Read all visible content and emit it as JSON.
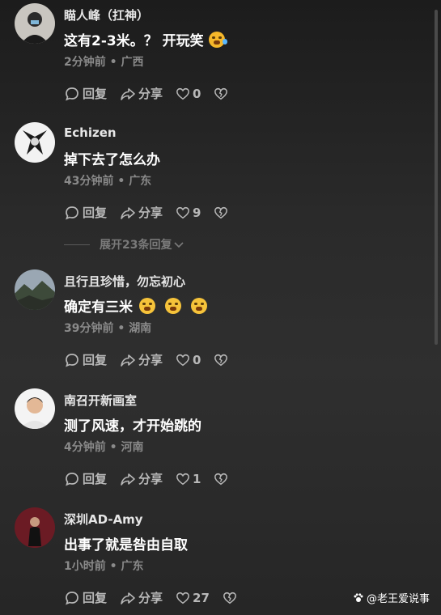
{
  "actions": {
    "reply": "回复",
    "share": "分享"
  },
  "comments": [
    {
      "username": "瞄人峰（扛神）",
      "text": "这有2-3米。？ 开玩笑",
      "time": "2分钟前",
      "location": "广西",
      "likes": "0"
    },
    {
      "username": "Echizen",
      "text": "掉下去了怎么办",
      "time": "43分钟前",
      "location": "广东",
      "likes": "9"
    },
    {
      "username": "且行且珍惜，勿忘初心",
      "text": "确定有三米",
      "time": "39分钟前",
      "location": "湖南",
      "likes": "0"
    },
    {
      "username": "南召开新画室",
      "text": "测了风速，才开始跳的",
      "time": "4分钟前",
      "location": "河南",
      "likes": "1"
    },
    {
      "username": "深圳AD-Amy",
      "text": "出事了就是咎由自取",
      "time": "1小时前",
      "location": "广东",
      "likes": "27"
    }
  ],
  "expand_replies": "展开23条回复",
  "meta_separator": "•",
  "watermark": "@老王爱说事",
  "colors": {
    "background": "#1e1e1e",
    "text": "#ffffff",
    "secondary": "#8a8a8a",
    "action": "#b8b8b8"
  }
}
